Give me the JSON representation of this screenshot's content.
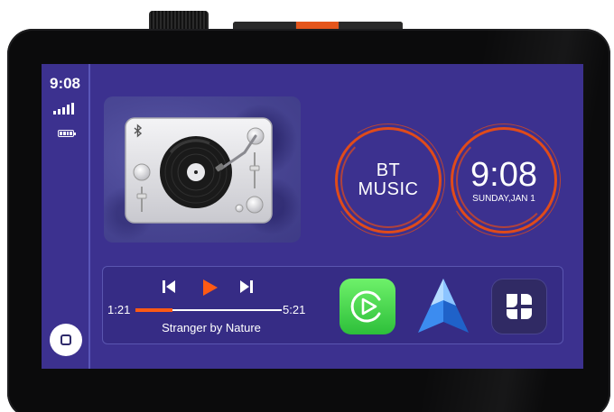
{
  "status": {
    "time": "9:08",
    "signal_icon": "signal-bars-icon",
    "battery_icon": "battery-icon"
  },
  "music_widget": {
    "image": "turntable-record-player",
    "bluetooth_icon": "bluetooth-icon"
  },
  "bt_music": {
    "line1": "BT",
    "line2": "MUSIC"
  },
  "clock_widget": {
    "time": "9:08",
    "date": "SUNDAY,JAN 1"
  },
  "player": {
    "elapsed": "1:21",
    "duration": "5:21",
    "progress_fraction": 0.25,
    "title": "Stranger by Nature",
    "prev_icon": "skip-previous-icon",
    "play_icon": "play-icon",
    "next_icon": "skip-next-icon"
  },
  "apps": [
    {
      "name": "carplay",
      "icon": "carplay-icon"
    },
    {
      "name": "android-auto",
      "icon": "android-auto-icon"
    },
    {
      "name": "more-apps",
      "icon": "app-grid-icon"
    }
  ],
  "colors": {
    "screen_bg": "#3c318f",
    "accent": "#e04b1a",
    "play": "#ff5a14",
    "carplay_green": "#39d046"
  }
}
